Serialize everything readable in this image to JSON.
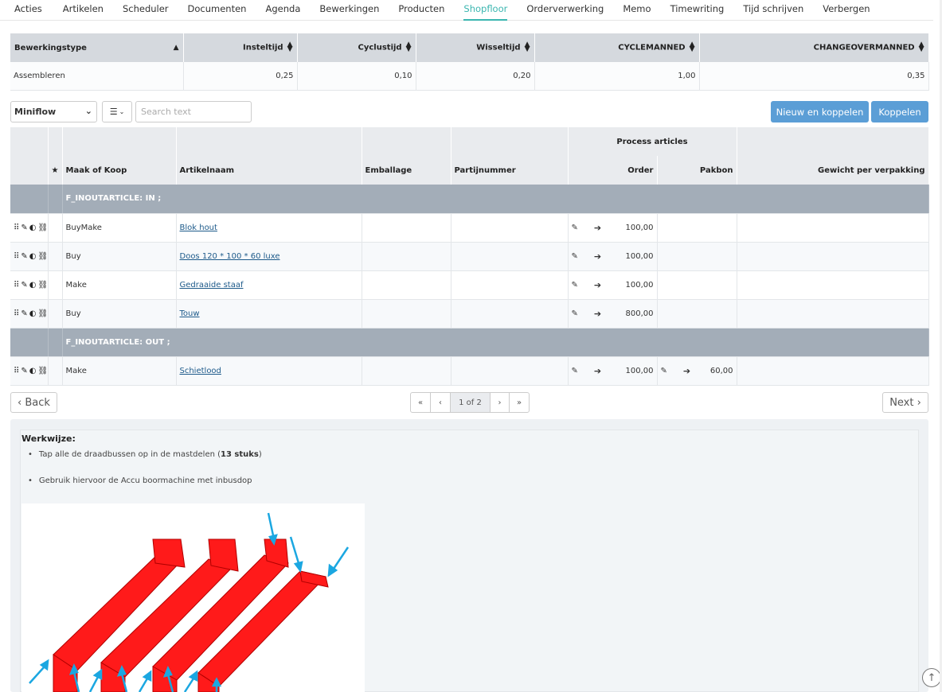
{
  "nav": {
    "tabs": [
      "Acties",
      "Artikelen",
      "Scheduler",
      "Documenten",
      "Agenda",
      "Bewerkingen",
      "Producten",
      "Shopfloor",
      "Orderverwerking",
      "Memo",
      "Timewriting",
      "Tijd schrijven",
      "Verbergen"
    ],
    "active": "Shopfloor"
  },
  "bewerking": {
    "headers": [
      "Bewerkingstype",
      "Insteltijd",
      "Cyclustijd",
      "Wisseltijd",
      "CYCLEMANNED",
      "CHANGEOVERMANNED"
    ],
    "row": [
      "Assembleren",
      "0,25",
      "0,10",
      "0,20",
      "1,00",
      "0,35"
    ]
  },
  "toolbar": {
    "select_value": "Miniflow",
    "search_placeholder": "Search text",
    "btn_new_link": "Nieuw en koppelen",
    "btn_link": "Koppelen"
  },
  "grid": {
    "group_header": "Process articles",
    "columns": [
      "Maak of Koop",
      "Artikelnaam",
      "Emballage",
      "Partijnummer",
      "Order",
      "Pakbon",
      "Gewicht per verpakking"
    ],
    "groups": [
      {
        "label": "F_INOUTARTICLE: IN ;",
        "rows": [
          {
            "type": "BuyMake",
            "name": "Blok hout",
            "order": "100,00",
            "pakbon": ""
          },
          {
            "type": "Buy",
            "name": "Doos 120 * 100 * 60 luxe",
            "order": "100,00",
            "pakbon": ""
          },
          {
            "type": "Make",
            "name": "Gedraaide staaf",
            "order": "100,00",
            "pakbon": ""
          },
          {
            "type": "Buy",
            "name": "Touw",
            "order": "800,00",
            "pakbon": ""
          }
        ]
      },
      {
        "label": "F_INOUTARTICLE: OUT ;",
        "rows": [
          {
            "type": "Make",
            "name": "Schietlood",
            "order": "100,00",
            "pakbon": "60,00"
          }
        ]
      }
    ]
  },
  "pager": {
    "back": "‹ Back",
    "next": "Next ›",
    "first": "«",
    "prev": "‹",
    "current": "1 of 2",
    "nextp": "›",
    "last": "»"
  },
  "werkwijze": {
    "title": "Werkwijze:",
    "line1_pre": "Tap alle de draadbussen op in de mastdelen (",
    "line1_bold": "13 stuks",
    "line1_post": ")",
    "line2": "Gebruik hiervoor de Accu boormachine met inbusdop"
  },
  "colors": {
    "accent": "#3bb6b0",
    "button_blue": "#5b9ed6",
    "group_row": "#a3adb8",
    "part_red": "#ff1a1a",
    "arrow_blue": "#1ba7e1"
  }
}
